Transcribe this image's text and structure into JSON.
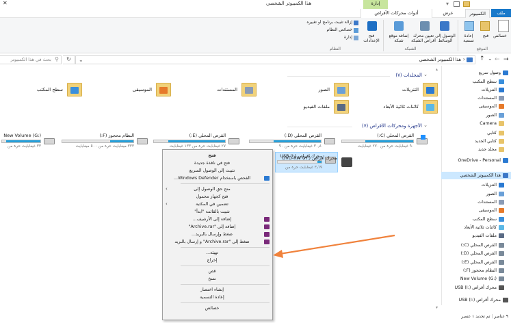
{
  "window": {
    "title": "هذا الكمبيوتر الشخصي",
    "manage_tab": "إدارة",
    "drive_tools_tab": "أدوات محركات الأقراص",
    "controls": {
      "minimize": "─",
      "maximize": "☐",
      "close": "✕"
    }
  },
  "ribbon": {
    "tabs": [
      "ملف",
      "الكمبيوتر",
      "عرض"
    ],
    "groups": {
      "location": "الموقع",
      "network": "الشبكة",
      "system": "النظام"
    },
    "buttons": {
      "properties": "خصائص",
      "open": "فتح",
      "rename": "إعادة تسمية",
      "access_media": "الوصول إلى الوسائط",
      "map_drive": "تعيين محرك أقراص الشبكة",
      "add_location": "إضافة موقع شبكة",
      "open_settings": "فتح الإعدادات",
      "uninstall": "إزالة تثبيت برنامج أو تغييره",
      "system_props": "خصائص النظام",
      "manage": "إدارة"
    }
  },
  "address": {
    "path": "هذا الكمبيوتر الشخصي",
    "search_placeholder": "بحث في هذا الكمبيوتر",
    "nav": {
      "back": "←",
      "forward": "→",
      "up": "↑",
      "recent": "⌄",
      "refresh": "↻",
      "dropdown": "⌄"
    }
  },
  "sidebar": {
    "items": [
      {
        "label": "وصول سريع",
        "icon": "star-icon"
      },
      {
        "label": "سطح المكتب",
        "icon": "desktop-icon"
      },
      {
        "label": "التنزيلات",
        "icon": "download-icon"
      },
      {
        "label": "المستندات",
        "icon": "documents-icon"
      },
      {
        "label": "الموسيقى",
        "icon": "music-icon"
      },
      {
        "label": "الصور",
        "icon": "pictures-icon"
      },
      {
        "label": "Camera",
        "icon": "folder-icon"
      },
      {
        "label": "كتابي",
        "icon": "folder-icon"
      },
      {
        "label": "كتابي الجديد",
        "icon": "folder-icon"
      },
      {
        "label": "مجلد جديد",
        "icon": "folder-icon"
      },
      {
        "label": "OneDrive - Personal",
        "icon": "cloud-icon"
      },
      {
        "label": "هذا الكمبيوتر الشخصي",
        "icon": "computer-icon"
      },
      {
        "label": "التنزيلات",
        "icon": "download-icon"
      },
      {
        "label": "الصور",
        "icon": "pictures-icon"
      },
      {
        "label": "المستندات",
        "icon": "documents-icon"
      },
      {
        "label": "الموسيقى",
        "icon": "music-icon"
      },
      {
        "label": "سطح المكتب",
        "icon": "desktop-icon"
      },
      {
        "label": "كائنات ثلاثية الأبعاد",
        "icon": "objects-icon"
      },
      {
        "label": "ملفات الفيديو",
        "icon": "video-icon"
      },
      {
        "label": "القرص المحلي (C:)",
        "icon": "drive-icon"
      },
      {
        "label": "القرص المحلي (D:)",
        "icon": "drive-icon"
      },
      {
        "label": "القرص المحلي (E:)",
        "icon": "drive-icon"
      },
      {
        "label": "النظام محجوز (F:)",
        "icon": "drive-icon"
      },
      {
        "label": "New Volume (G:)",
        "icon": "drive-icon"
      },
      {
        "label": "محرك أقراص USB (I:)",
        "icon": "usb-icon"
      },
      {
        "label": "محرك أقراص USB (I:)",
        "icon": "usb-icon"
      }
    ]
  },
  "status": {
    "items": "٩ عناصر",
    "selected": "تم تحديد ١ عنصر"
  },
  "folders": {
    "header": "المجلدات (٧)",
    "items": [
      {
        "label": "التنزيلات",
        "icon": "downloads-folder-icon"
      },
      {
        "label": "الصور",
        "icon": "pictures-folder-icon"
      },
      {
        "label": "المستندات",
        "icon": "documents-folder-icon"
      },
      {
        "label": "الموسيقى",
        "icon": "music-folder-icon"
      },
      {
        "label": "سطح المكتب",
        "icon": "desktop-folder-icon"
      },
      {
        "label": "كائنات ثلاثية الأبعاد",
        "icon": "3d-objects-folder-icon"
      },
      {
        "label": "ملفات الفيديو",
        "icon": "videos-folder-icon"
      }
    ]
  },
  "drives": {
    "header": "الأجهزة ومحركات الأقراص (٧)",
    "items": [
      {
        "label": "القرص المحلي (C:)",
        "free": "٩٠ غيغابايت حرة من ٢٧٠ غيغابايت",
        "fill": 0.67
      },
      {
        "label": "القرص المحلي (D:)",
        "free": "٣٠٫٤ غيغابايت حرة من ٩٠",
        "fill": 0.66
      },
      {
        "label": "القرص المحلي (E:)",
        "free": "٢٧ غيغابايت حرة من ١٣٣ غيغابايت",
        "fill": 0.8
      },
      {
        "label": "النظام محجوز (F:)",
        "free": "٣٣٣ ميغابايت حرة من ٥٠٠ ميغابايت",
        "fill": 0.33
      },
      {
        "label": "New Volume (G:)",
        "free": "٣٣ غيغابايت حرة من",
        "fill": 0.9
      },
      {
        "label": "محرك أقراص USB (I:)",
        "free": "٣٫٦٩ غيغابايت حرة من",
        "fill": 0.1
      },
      {
        "label": "محرك أقراص DVD-RW (H:)",
        "free": ""
      }
    ]
  },
  "context_menu": {
    "items": [
      {
        "label": "فتح",
        "bold": true
      },
      {
        "label": "فتح في نافذة جديدة"
      },
      {
        "label": "تثبيت إلى الوصول السريع"
      },
      {
        "label": "الفحص باستخدام Windows Defender...",
        "icon": "defender-icon"
      },
      {
        "sep": true
      },
      {
        "label": "منح حق الوصول إلى",
        "arrow": true
      },
      {
        "label": "فتح كجهاز محمول"
      },
      {
        "label": "تضمين في المكتبة",
        "arrow": true
      },
      {
        "label": "تثبيت بالقائمة \"ابدأ\""
      },
      {
        "label": "إضافة إلى الأرشيف...",
        "icon": "archive-icon"
      },
      {
        "label": "إضافة إلى \"Archive.rar\"",
        "icon": "archive-icon"
      },
      {
        "label": "ضغط وإرسال بالبريد...",
        "icon": "archive-icon"
      },
      {
        "label": "ضغط إلى \"Archive.rar\" و إرسال بالبريد",
        "icon": "archive-icon"
      },
      {
        "sep": true
      },
      {
        "label": "تهيئة..."
      },
      {
        "label": "إخراج"
      },
      {
        "sep": true
      },
      {
        "label": "قص"
      },
      {
        "label": "نسخ"
      },
      {
        "sep": true
      },
      {
        "label": "إنشاء اختصار"
      },
      {
        "label": "إعادة التسمية"
      },
      {
        "sep": true
      },
      {
        "label": "خصائص"
      }
    ]
  },
  "colors": {
    "accent": "#1979ca",
    "selection": "#cce8ff",
    "manage_tab": "#c7e59d",
    "arrow": "#f0823c",
    "drive_bar": "#26a0da"
  }
}
